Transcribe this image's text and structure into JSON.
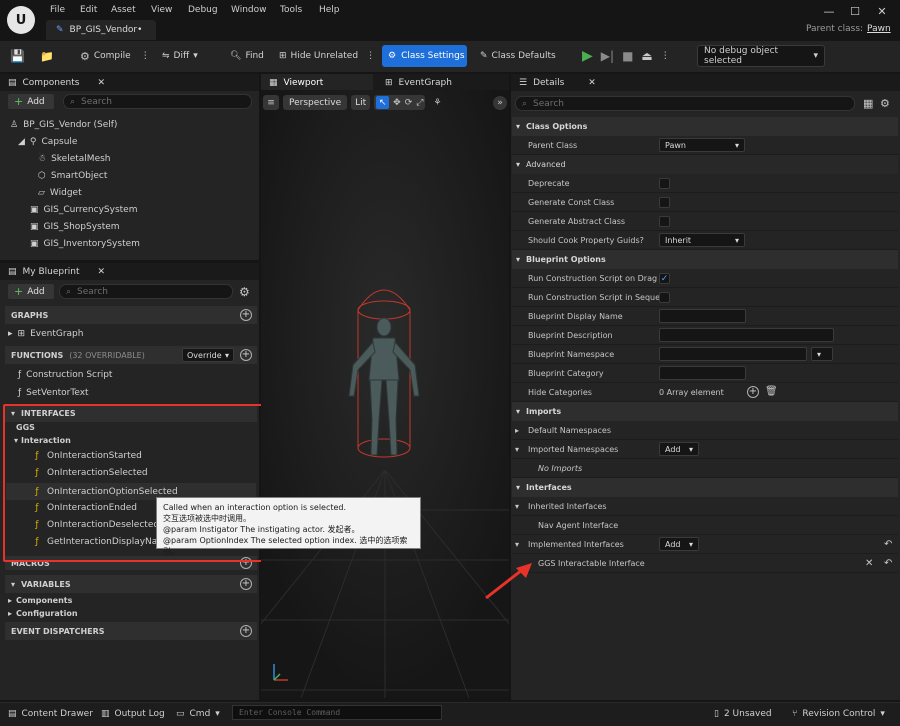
{
  "menu": [
    "File",
    "Edit",
    "Asset",
    "View",
    "Debug",
    "Window",
    "Tools",
    "Help"
  ],
  "asset_tab": "BP_GIS_Vendor•",
  "parent_class": {
    "label": "Parent class:",
    "value": "Pawn"
  },
  "toolbar": {
    "compile": "Compile",
    "diff": "Diff",
    "find": "Find",
    "hide_unrelated": "Hide Unrelated",
    "class_settings": "Class Settings",
    "class_defaults": "Class Defaults",
    "debug_object": "No debug object selected"
  },
  "components": {
    "tab": "Components",
    "add": "Add",
    "search_placeholder": "Search",
    "tree": [
      "BP_GIS_Vendor (Self)",
      "Capsule",
      "SkeletalMesh",
      "SmartObject",
      "Widget",
      "GIS_CurrencySystem",
      "GIS_ShopSystem",
      "GIS_InventorySystem"
    ]
  },
  "my_blueprint": {
    "tab": "My Blueprint",
    "add": "Add",
    "search_placeholder": "Search",
    "graphs_header": "GRAPHS",
    "graphs": [
      "EventGraph"
    ],
    "functions_header": "FUNCTIONS",
    "functions_count": "(32 OVERRIDABLE)",
    "override": "Override",
    "functions": [
      "Construction Script",
      "SetVentorText"
    ],
    "interfaces_header": "INTERFACES",
    "interface_group": "GGS",
    "interface_sub": "Interaction",
    "interface_functions": [
      "OnInteractionStarted",
      "OnInteractionSelected",
      "OnInteractionOptionSelected",
      "OnInteractionEnded",
      "OnInteractionDeselected",
      "GetInteractionDisplayName"
    ],
    "macros_header": "MACROS",
    "variables_header": "VARIABLES",
    "variables": [
      "Components",
      "Configuration"
    ],
    "dispatchers_header": "EVENT DISPATCHERS"
  },
  "tooltip": {
    "line1": "Called when an interaction option is selected.",
    "line2": "交互选项被选中时调用。",
    "line3": "@param Instigator The instigating actor. 发起者。",
    "line4": "@param OptionIndex The selected option index. 选中的选项索引。"
  },
  "viewport": {
    "tab": "Viewport",
    "graph_tab": "EventGraph",
    "perspective": "Perspective",
    "lit": "Lit"
  },
  "details": {
    "tab": "Details",
    "search_placeholder": "Search",
    "class_options": "Class Options",
    "parent_class_label": "Parent Class",
    "parent_class_value": "Pawn",
    "advanced": "Advanced",
    "deprecate": "Deprecate",
    "generate_const": "Generate Const Class",
    "generate_abstract": "Generate Abstract Class",
    "cook_guids": "Should Cook Property Guids?",
    "cook_guids_value": "Inherit",
    "blueprint_options": "Blueprint Options",
    "run_on_drag": "Run Construction Script on Drag",
    "run_on_drag_checked": true,
    "run_in_seq": "Run Construction Script in Seque...",
    "display_name": "Blueprint Display Name",
    "description": "Blueprint Description",
    "namespace": "Blueprint Namespace",
    "category": "Blueprint Category",
    "hide_categories": "Hide Categories",
    "hide_categories_value": "0 Array element",
    "imports": "Imports",
    "default_namespaces": "Default Namespaces",
    "imported_namespaces": "Imported Namespaces",
    "add": "Add",
    "no_imports": "No Imports",
    "interfaces": "Interfaces",
    "inherited_interfaces": "Inherited Interfaces",
    "nav_agent": "Nav Agent Interface",
    "implemented_interfaces": "Implemented Interfaces",
    "ggs_interface": "GGS Interactable Interface"
  },
  "bottom": {
    "content_drawer": "Content Drawer",
    "output_log": "Output Log",
    "cmd": "Cmd",
    "console_placeholder": "Enter Console Command",
    "unsaved": "2 Unsaved",
    "revision": "Revision Control"
  },
  "colors": {
    "accent_blue": "#1e6fd9",
    "annotation_red": "#e8332b",
    "play_green": "#4caf50"
  }
}
